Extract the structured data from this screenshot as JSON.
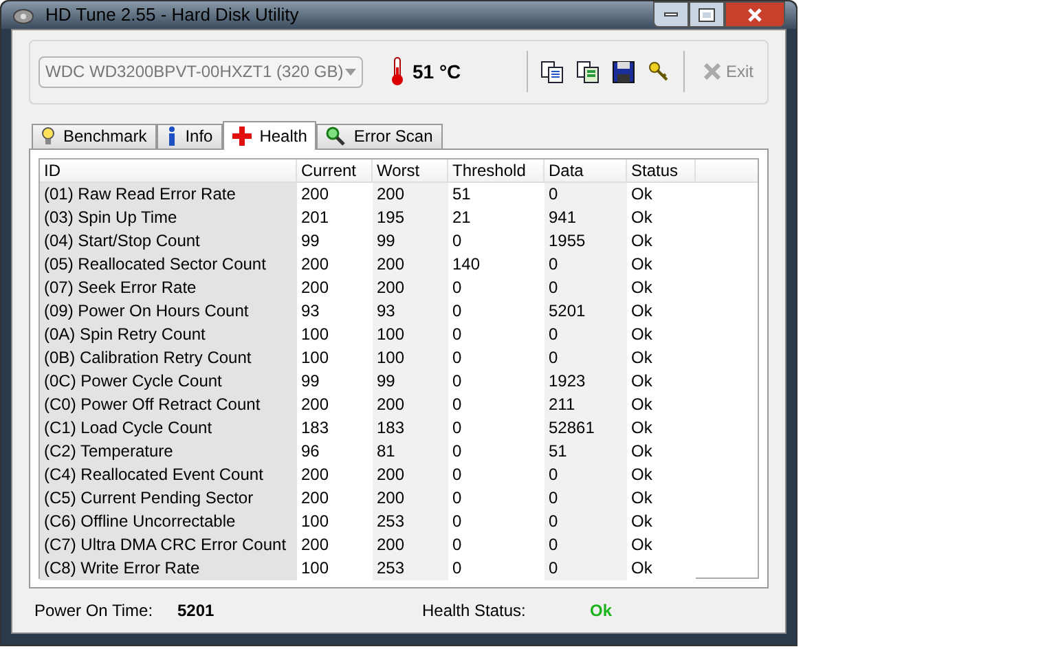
{
  "window": {
    "title": "HD Tune 2.55 - Hard Disk Utility"
  },
  "toolbar": {
    "drive": "WDC WD3200BPVT-00HXZT1 (320 GB)",
    "temperature": "51 °C",
    "exit": {
      "label": "Exit",
      "disabled": true
    }
  },
  "tabs": [
    {
      "label": "Benchmark",
      "selected": false
    },
    {
      "label": "Info",
      "selected": false
    },
    {
      "label": "Health",
      "selected": true
    },
    {
      "label": "Error Scan",
      "selected": false
    }
  ],
  "table": {
    "columns": [
      "ID",
      "Current",
      "Worst",
      "Threshold",
      "Data",
      "Status"
    ],
    "rows": [
      [
        "(01) Raw Read Error Rate",
        "200",
        "200",
        "51",
        "0",
        "Ok"
      ],
      [
        "(03) Spin Up Time",
        "201",
        "195",
        "21",
        "941",
        "Ok"
      ],
      [
        "(04) Start/Stop Count",
        "99",
        "99",
        "0",
        "1955",
        "Ok"
      ],
      [
        "(05) Reallocated Sector Count",
        "200",
        "200",
        "140",
        "0",
        "Ok"
      ],
      [
        "(07) Seek Error Rate",
        "200",
        "200",
        "0",
        "0",
        "Ok"
      ],
      [
        "(09) Power On Hours Count",
        "93",
        "93",
        "0",
        "5201",
        "Ok"
      ],
      [
        "(0A) Spin Retry Count",
        "100",
        "100",
        "0",
        "0",
        "Ok"
      ],
      [
        "(0B) Calibration Retry Count",
        "100",
        "100",
        "0",
        "0",
        "Ok"
      ],
      [
        "(0C) Power Cycle Count",
        "99",
        "99",
        "0",
        "1923",
        "Ok"
      ],
      [
        "(C0) Power Off Retract Count",
        "200",
        "200",
        "0",
        "211",
        "Ok"
      ],
      [
        "(C1) Load Cycle Count",
        "183",
        "183",
        "0",
        "52861",
        "Ok"
      ],
      [
        "(C2) Temperature",
        "96",
        "81",
        "0",
        "51",
        "Ok"
      ],
      [
        "(C4) Reallocated Event Count",
        "200",
        "200",
        "0",
        "0",
        "Ok"
      ],
      [
        "(C5) Current Pending Sector",
        "200",
        "200",
        "0",
        "0",
        "Ok"
      ],
      [
        "(C6) Offline Uncorrectable",
        "100",
        "253",
        "0",
        "0",
        "Ok"
      ],
      [
        "(C7) Ultra DMA CRC Error Count",
        "200",
        "200",
        "0",
        "0",
        "Ok"
      ],
      [
        "(C8) Write Error Rate",
        "100",
        "253",
        "0",
        "0",
        "Ok"
      ]
    ]
  },
  "footer": {
    "power_on_label": "Power On Time:",
    "power_on_value": "5201",
    "health_label": "Health Status:",
    "health_value": "Ok"
  }
}
